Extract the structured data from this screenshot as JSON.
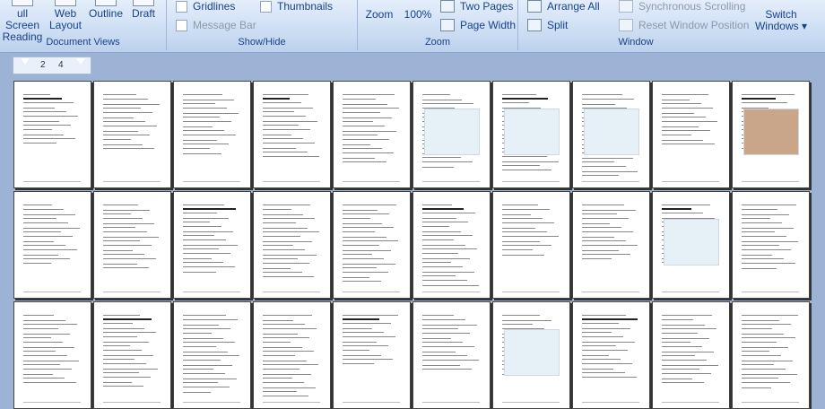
{
  "ribbon": {
    "document_views": {
      "label": "Document Views",
      "buttons": [
        {
          "name": "full-screen-reading-button",
          "l1": "ull Screen",
          "l2": "Reading"
        },
        {
          "name": "web-layout-button",
          "l1": "Web",
          "l2": "Layout"
        },
        {
          "name": "outline-button",
          "l1": "Outline",
          "l2": ""
        },
        {
          "name": "draft-button",
          "l1": "Draft",
          "l2": ""
        }
      ]
    },
    "show_hide": {
      "label": "Show/Hide",
      "gridlines": "Gridlines",
      "thumbnails": "Thumbnails",
      "message_bar": "Message Bar"
    },
    "zoom": {
      "label": "Zoom",
      "zoom_button": "Zoom",
      "percent_button": "100%",
      "two_pages": "Two Pages",
      "page_width": "Page Width"
    },
    "window": {
      "label": "Window",
      "arrange_all": "Arrange All",
      "split": "Split",
      "sync_scrolling": "Synchronous Scrolling",
      "reset_position": "Reset Window Position",
      "switch_windows_l1": "Switch",
      "switch_windows_l2": "Windows"
    }
  },
  "ruler": {
    "ticks": [
      "2",
      "4"
    ]
  },
  "thumbnails": {
    "rows": 3,
    "cols": 10
  }
}
